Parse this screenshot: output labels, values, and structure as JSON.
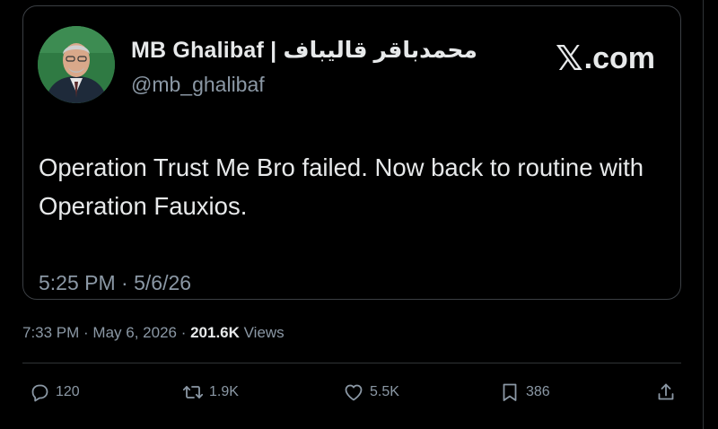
{
  "author": {
    "display_name": "MB Ghalibaf | محمدباقر قالیباف",
    "handle": "@mb_ghalibaf"
  },
  "brand": {
    "x_glyph": "𝕏",
    "suffix": ".com"
  },
  "tweet": {
    "text": "Operation Trust Me Bro failed. Now back to routine with Operation Fauxios.",
    "inner_timestamp": "5:25 PM · 5/6/26"
  },
  "meta": {
    "time": "7:33 PM",
    "separator": " · ",
    "date": "May 6, 2026",
    "views_count": "201.6K",
    "views_label": " Views"
  },
  "actions": {
    "replies": "120",
    "reposts": "1.9K",
    "likes": "5.5K",
    "bookmarks": "386"
  },
  "icons": [
    "reply-icon",
    "repost-icon",
    "like-icon",
    "bookmark-icon",
    "share-icon"
  ],
  "colors": {
    "background": "#000000",
    "text": "#e7e9ea",
    "muted": "#8b98a5",
    "border": "#3b3f44"
  }
}
